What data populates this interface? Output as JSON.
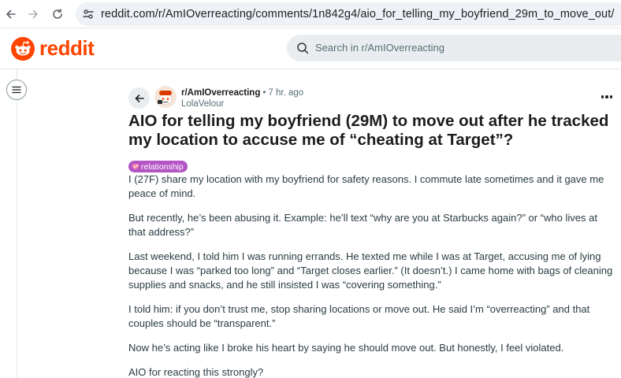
{
  "browser": {
    "url": "reddit.com/r/AmIOverreacting/comments/1n842g4/aio_for_telling_my_boyfriend_29m_to_move_out/"
  },
  "header": {
    "logo_text": "reddit",
    "search_placeholder": "Search in r/AmIOverreacting",
    "brand_color": "#ff4500"
  },
  "post": {
    "subreddit": "r/AmIOverreacting",
    "separator": "•",
    "time": "7 hr. ago",
    "author": "LolaVelour",
    "title": "AIO for telling my boyfriend (29M) to move out after he tracked my location to accuse me of “cheating at Target”?",
    "flair": "relationship",
    "flair_color": "#b455c5",
    "paragraphs": [
      "I (27F) share my location with my boyfriend for safety reasons. I commute late sometimes and it gave me peace of mind.",
      "But recently, he’s been abusing it. Example: he’ll text “why are you at Starbucks again?” or “who lives at that address?”",
      "Last weekend, I told him I was running errands. He texted me while I was at Target, accusing me of lying because I was “parked too long” and “Target closes earlier.” (It doesn’t.) I came home with bags of cleaning supplies and snacks, and he still insisted I was “covering something.”",
      "I told him: if you don’t trust me, stop sharing locations or move out. He said I’m “overreacting” and that couples should be “transparent.”",
      "Now he’s acting like I broke his heart by saying he should move out. But honestly, I feel violated.",
      "AIO for reacting this strongly?"
    ]
  }
}
